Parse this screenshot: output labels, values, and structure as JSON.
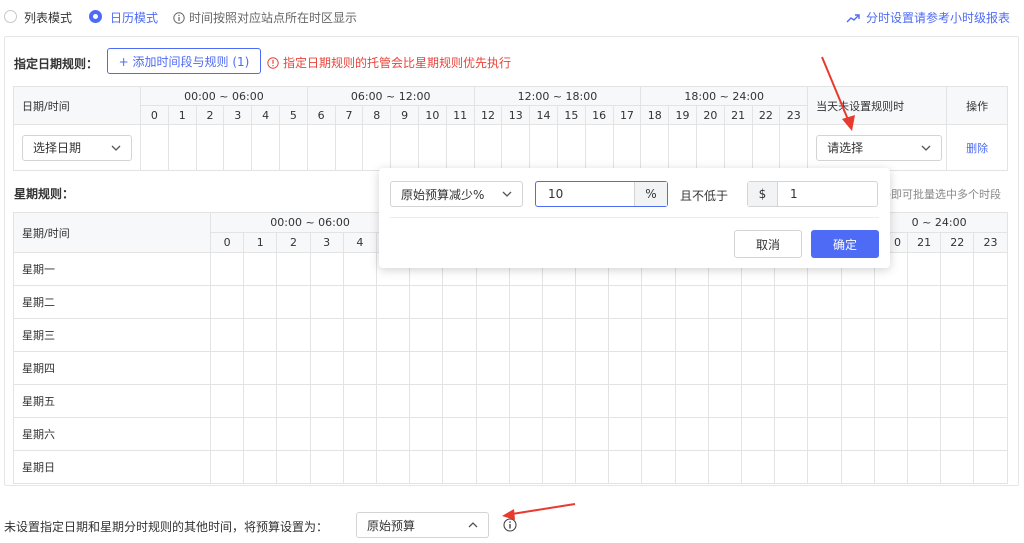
{
  "top_bar": {
    "list_mode": "列表模式",
    "calendar_mode": "日历模式",
    "tz_note": "时间按照对应站点所在时区显示",
    "report_link": "分时设置请参考小时级报表"
  },
  "date_rules": {
    "title": "指定日期规则：",
    "add_button": "+ 添加时间段与规则 (1)",
    "warning": "指定日期规则的托管会比星期规则优先执行",
    "col_date": "日期/时间",
    "col_unset": "当天未设置规则时",
    "col_action": "操作",
    "ranges": [
      "00:00 ~ 06:00",
      "06:00 ~ 12:00",
      "12:00 ~ 18:00",
      "18:00 ~ 24:00"
    ],
    "hours": [
      "0",
      "1",
      "2",
      "3",
      "4",
      "5",
      "6",
      "7",
      "8",
      "9",
      "10",
      "11",
      "12",
      "13",
      "14",
      "15",
      "16",
      "17",
      "18",
      "19",
      "20",
      "21",
      "22",
      "23"
    ],
    "date_select": "选择日期",
    "rule_select": "请选择",
    "delete": "删除"
  },
  "week_rules": {
    "title": "星期规则：",
    "hint_partial": "格即可批量选中多个时段",
    "col_week": "星期/时间",
    "range_first": "00:00 ~ 06:00",
    "range_last_partial": "0 ~ 24:00",
    "hours_left": [
      "0",
      "1",
      "2",
      "3",
      "4"
    ],
    "hours_right_partial": "0",
    "hours_right": [
      "21",
      "22",
      "23"
    ],
    "days": [
      "星期一",
      "星期二",
      "星期三",
      "星期四",
      "星期五",
      "星期六",
      "星期日"
    ]
  },
  "popover": {
    "mode_select": "原始预算减少%",
    "value": "10",
    "unit": "%",
    "min_label": "且不低于",
    "currency": "$",
    "min_value": "1",
    "cancel": "取消",
    "confirm": "确定"
  },
  "footer": {
    "label": "未设置指定日期和星期分时规则的其他时间，将预算设置为：",
    "select": "原始预算"
  },
  "colors": {
    "accent": "#4e6bf5",
    "warning_red": "#e8433a",
    "annotation_arrow": "#e83a2e"
  }
}
